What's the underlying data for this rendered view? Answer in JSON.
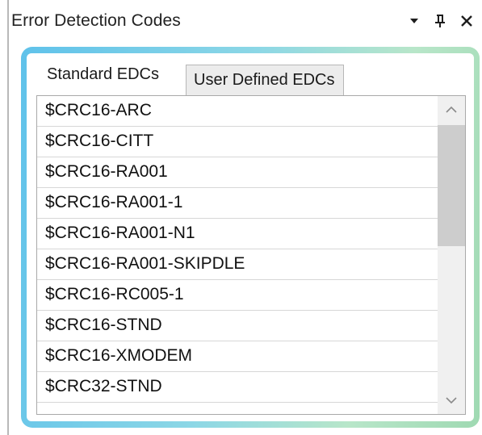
{
  "panel": {
    "title": "Error Detection Codes",
    "buttons": {
      "dropdown_icon": "dropdown-arrow-icon",
      "pin_icon": "pin-icon",
      "close_icon": "close-icon"
    }
  },
  "tabs": [
    {
      "label": "Standard EDCs",
      "active": true
    },
    {
      "label": "User Defined EDCs",
      "active": false
    }
  ],
  "list": {
    "items": [
      "$CRC16-ARC",
      "$CRC16-CITT",
      "$CRC16-RA001",
      "$CRC16-RA001-1",
      "$CRC16-RA001-N1",
      "$CRC16-RA001-SKIPDLE",
      "$CRC16-RC005-1",
      "$CRC16-STND",
      "$CRC16-XMODEM",
      "$CRC32-STND"
    ]
  },
  "colors": {
    "panel_gradient_start": "#5fc2ea",
    "panel_gradient_end": "#9fd9b2",
    "scroll_thumb": "#cdcdcd"
  }
}
